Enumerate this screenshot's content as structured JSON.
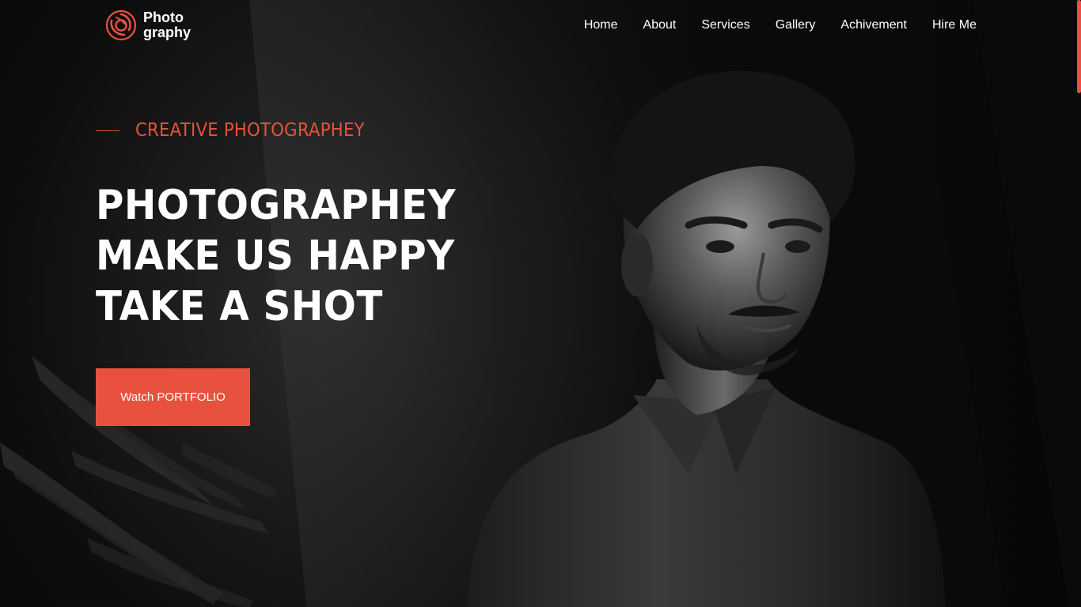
{
  "brand": {
    "line1": "Photo",
    "line2": "graphy",
    "accent_color": "#e9513f",
    "icon": "aperture-swirl-icon"
  },
  "nav": {
    "items": [
      {
        "label": "Home"
      },
      {
        "label": "About"
      },
      {
        "label": "Services"
      },
      {
        "label": "Gallery"
      },
      {
        "label": "Achivement"
      },
      {
        "label": "Hire Me"
      }
    ]
  },
  "hero": {
    "eyebrow": "CREATIVE PHOTOGRAPHEY",
    "headline": [
      "PHOTOGRAPHEY",
      "MAKE US HAPPY",
      "TAKE A SHOT"
    ],
    "cta_label": "Watch PORTFOLIO",
    "portrait_icon": "portrait-photo"
  },
  "colors": {
    "background": "#0b0b0b",
    "accent": "#e9513f",
    "text": "#ffffff"
  }
}
